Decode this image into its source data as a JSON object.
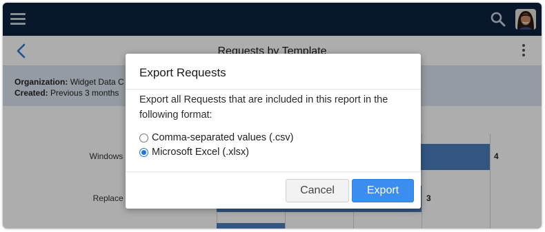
{
  "topbar": {
    "menu_icon": "hamburger-menu-icon",
    "search_icon": "search-icon",
    "avatar_icon": "user-avatar"
  },
  "header": {
    "back_icon": "chevron-left-icon",
    "title": "Requests by Template",
    "more_icon": "vertical-ellipsis-icon"
  },
  "filters": {
    "organization_label": "Organization:",
    "organization_value": "Widget Data C",
    "created_label": "Created:",
    "created_value": "Previous 3 months"
  },
  "chart": {
    "rows": [
      {
        "label": "Windows pas",
        "value": "4"
      },
      {
        "label": "Replace to",
        "value": "3"
      }
    ]
  },
  "chart_data": {
    "type": "bar",
    "orientation": "horizontal",
    "categories": [
      "Windows pas",
      "Replace to"
    ],
    "values": [
      4,
      3
    ]
  },
  "modal": {
    "title": "Export Requests",
    "description": "Export all Requests that are included in this report in the following format:",
    "options": [
      {
        "label": "Comma-separated values (.csv)",
        "checked": false
      },
      {
        "label": "Microsoft Excel (.xlsx)",
        "checked": true
      }
    ],
    "cancel_label": "Cancel",
    "export_label": "Export"
  },
  "colors": {
    "topbar": "#0e2240",
    "accent": "#3c8df0",
    "bar": "#4a7fbd"
  }
}
